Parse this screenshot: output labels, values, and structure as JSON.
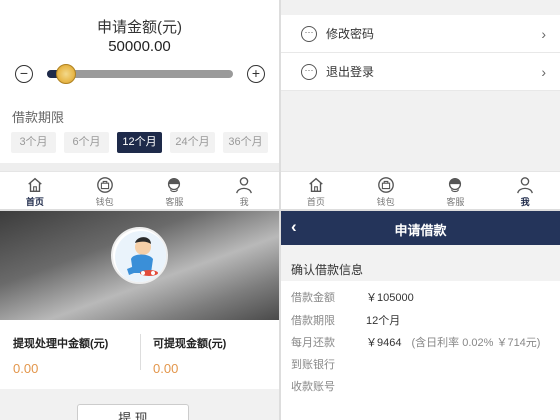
{
  "loan_apply": {
    "title": "申请金额(元)",
    "amount": "50000.00",
    "minus_glyph": "−",
    "plus_glyph": "+",
    "slider_fraction": 0.1,
    "term_label": "借款期限",
    "terms": [
      "3个月",
      "6个月",
      "12个月",
      "24个月",
      "36个月"
    ],
    "selected_term_index": 2
  },
  "nav": {
    "items": [
      {
        "label": "首页",
        "icon": "home-icon"
      },
      {
        "label": "钱包",
        "icon": "wallet-icon"
      },
      {
        "label": "客服",
        "icon": "service-icon"
      },
      {
        "label": "我",
        "icon": "user-icon"
      }
    ]
  },
  "settings": {
    "items": [
      {
        "label": "修改密码",
        "icon": "more-icon"
      },
      {
        "label": "退出登录",
        "icon": "more-icon"
      }
    ],
    "chevron": "›"
  },
  "wallet": {
    "processing_label": "提现处理中金额(元)",
    "processing_value": "0.00",
    "available_label": "可提现金额(元)",
    "available_value": "0.00",
    "withdraw_button": "提 现"
  },
  "confirm": {
    "header_title": "申请借款",
    "back_glyph": "‹",
    "section_title": "确认借款信息",
    "rows": [
      {
        "label": "借款金额",
        "value": "￥105000",
        "note": ""
      },
      {
        "label": "借款期限",
        "value": "12个月",
        "note": ""
      },
      {
        "label": "每月还款",
        "value": "￥9464",
        "note": "(含日利率 0.02% ￥714元)"
      },
      {
        "label": "到账银行",
        "value": "",
        "note": ""
      },
      {
        "label": "收款账号",
        "value": "",
        "note": ""
      }
    ]
  },
  "colors": {
    "brand_dark": "#1e2a4a",
    "header": "#24345a",
    "amount_orange": "#e3964b"
  }
}
